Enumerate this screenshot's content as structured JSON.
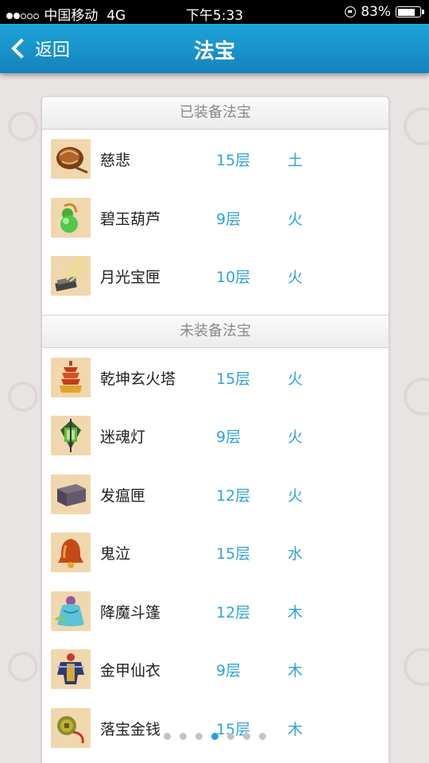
{
  "status_bar": {
    "carrier": "中国移动",
    "network": "4G",
    "time": "下午5:33",
    "battery": "83%",
    "battery_level": 0.83
  },
  "nav": {
    "back_label": "返回",
    "title": "法宝"
  },
  "equipped": {
    "header": "已装备法宝",
    "items": [
      {
        "name": "慈悲",
        "layer": "15层",
        "element": "土",
        "icon": "drum-icon"
      },
      {
        "name": "碧玉葫芦",
        "layer": "9层",
        "element": "火",
        "icon": "gourd-icon"
      },
      {
        "name": "月光宝匣",
        "layer": "10层",
        "element": "火",
        "icon": "moonlight-box-icon"
      }
    ]
  },
  "unequipped": {
    "header": "未装备法宝",
    "items": [
      {
        "name": "乾坤玄火塔",
        "layer": "15层",
        "element": "火",
        "icon": "pagoda-icon"
      },
      {
        "name": "迷魂灯",
        "layer": "9层",
        "element": "火",
        "icon": "lantern-icon"
      },
      {
        "name": "发瘟匣",
        "layer": "12层",
        "element": "火",
        "icon": "plague-box-icon"
      },
      {
        "name": "鬼泣",
        "layer": "15层",
        "element": "水",
        "icon": "bell-icon"
      },
      {
        "name": "降魔斗篷",
        "layer": "12层",
        "element": "木",
        "icon": "cloak-icon"
      },
      {
        "name": "金甲仙衣",
        "layer": "9层",
        "element": "木",
        "icon": "armor-icon"
      },
      {
        "name": "落宝金钱",
        "layer": "15层",
        "element": "木",
        "icon": "coin-icon"
      }
    ]
  },
  "pager": {
    "count": 7,
    "active_index": 3
  },
  "colors": {
    "nav_bg": "#1a96cf",
    "accent": "#2fa3d6",
    "icon_bg": "#f1d7ad"
  }
}
